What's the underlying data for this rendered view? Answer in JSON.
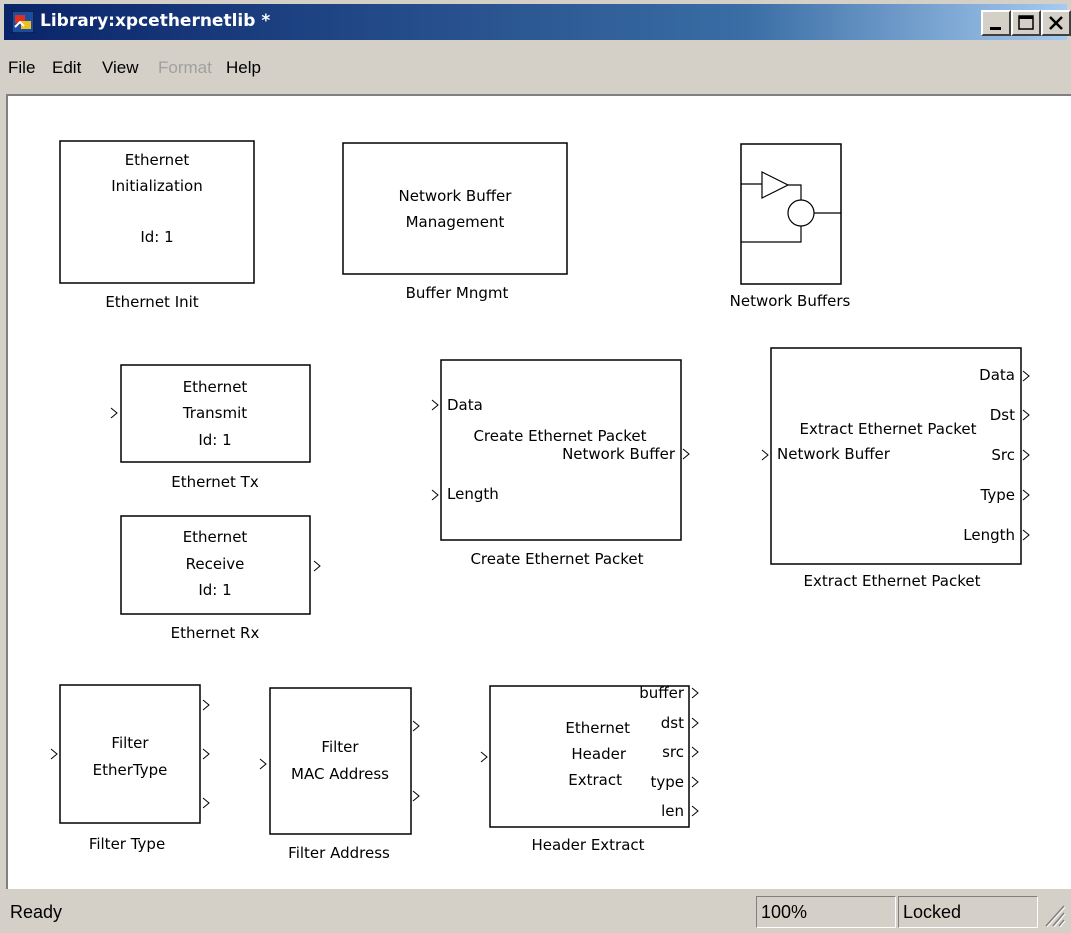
{
  "window": {
    "title": "Library:xpcethernetlib *",
    "controls": [
      "minimize-icon",
      "maximize-icon",
      "close-icon"
    ]
  },
  "menu": {
    "items": [
      {
        "label": "File",
        "enabled": true
      },
      {
        "label": "Edit",
        "enabled": true
      },
      {
        "label": "View",
        "enabled": true
      },
      {
        "label": "Format",
        "enabled": false
      },
      {
        "label": "Help",
        "enabled": true
      }
    ]
  },
  "blocks": {
    "eth_init": {
      "line1": "Ethernet",
      "line2": "Initialization",
      "line3": "Id: 1",
      "caption": "Ethernet Init"
    },
    "buffer_mngmt": {
      "line1": "Network Buffer",
      "line2": "Management",
      "caption": "Buffer Mngmt"
    },
    "net_buffers": {
      "caption": "Network Buffers"
    },
    "eth_tx": {
      "line1": "Ethernet",
      "line2": "Transmit",
      "line3": "Id: 1",
      "caption": "Ethernet Tx"
    },
    "eth_rx": {
      "line1": "Ethernet",
      "line2": "Receive",
      "line3": "Id: 1",
      "caption": "Ethernet Rx"
    },
    "create_packet": {
      "in1": "Data",
      "in2": "Length",
      "center": "Create Ethernet Packet",
      "out1": "Network Buffer",
      "caption": "Create Ethernet Packet"
    },
    "extract_packet": {
      "center": "Extract Ethernet Packet",
      "in1": "Network Buffer",
      "out1": "Data",
      "out2": "Dst",
      "out3": "Src",
      "out4": "Type",
      "out5": "Length",
      "caption": "Extract Ethernet Packet"
    },
    "filter_type": {
      "line1": "Filter",
      "line2": "EtherType",
      "caption": "Filter Type"
    },
    "filter_address": {
      "line1": "Filter",
      "line2": "MAC Address",
      "caption": "Filter Address"
    },
    "header_extract": {
      "line1": "Ethernet",
      "line2": "Header",
      "line3": "Extract",
      "out1": "buffer",
      "out2": "dst",
      "out3": "src",
      "out4": "type",
      "out5": "len",
      "caption": "Header Extract"
    }
  },
  "status": {
    "text": "Ready",
    "zoom": "100%",
    "lock": "Locked"
  },
  "colors": {
    "titlebar_start": "#0a246a",
    "titlebar_end": "#a6caf0",
    "chrome": "#d4d0c8",
    "canvas": "#ffffff"
  }
}
